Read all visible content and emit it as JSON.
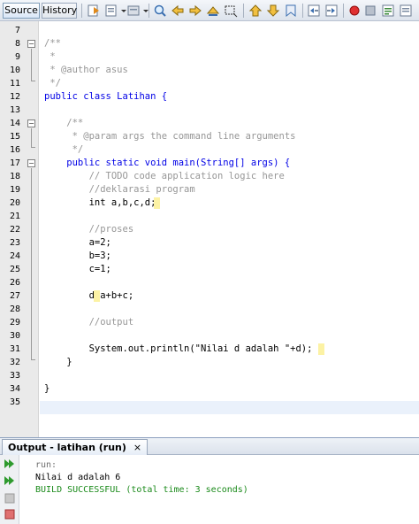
{
  "tabs": {
    "source": "Source",
    "history": "History"
  },
  "colors": {
    "keyword": "#0000e6",
    "comment": "#969696",
    "string": "#ce7b00",
    "highlight": "#fcf2a4",
    "success": "#1a8a1a"
  },
  "toolbar_icons": [
    "back-icon",
    "forward-icon",
    "go-to-icon",
    "find-previous-icon",
    "find-next-icon",
    "find-selection-icon",
    "toggle-highlight-icon",
    "toggle-rectangular-icon",
    "shift-left-icon",
    "shift-right-icon",
    "toggle-bookmark-icon",
    "previous-bookmark-icon",
    "next-bookmark-icon",
    "comment-icon",
    "uncomment-icon",
    "start-macro-icon",
    "stop-macro-icon",
    "run-icon"
  ],
  "editor": {
    "lines": [
      {
        "n": "7",
        "t": ""
      },
      {
        "n": "8",
        "t": "/**"
      },
      {
        "n": "9",
        "t": " *"
      },
      {
        "n": "10",
        "t": " * @author asus"
      },
      {
        "n": "11",
        "t": " */"
      },
      {
        "n": "12",
        "t": "public class Latihan {"
      },
      {
        "n": "13",
        "t": ""
      },
      {
        "n": "14",
        "t": "    /**"
      },
      {
        "n": "15",
        "t": "     * @param args the command line arguments"
      },
      {
        "n": "16",
        "t": "     */"
      },
      {
        "n": "17",
        "t": "    public static void main(String[] args) {"
      },
      {
        "n": "18",
        "t": "        // TODO code application logic here"
      },
      {
        "n": "19",
        "t": "        //deklarasi program"
      },
      {
        "n": "20",
        "t": "        int a,b,c,d;"
      },
      {
        "n": "21",
        "t": ""
      },
      {
        "n": "22",
        "t": "        //proses"
      },
      {
        "n": "23",
        "t": "        a=2;"
      },
      {
        "n": "24",
        "t": "        b=3;"
      },
      {
        "n": "25",
        "t": "        c=1;"
      },
      {
        "n": "26",
        "t": ""
      },
      {
        "n": "27",
        "t": "        d=a+b+c;"
      },
      {
        "n": "28",
        "t": ""
      },
      {
        "n": "29",
        "t": "        //output"
      },
      {
        "n": "30",
        "t": ""
      },
      {
        "n": "31",
        "t": "        System.out.println(\"Nilai d adalah \"+d);"
      },
      {
        "n": "32",
        "t": "    }"
      },
      {
        "n": "33",
        "t": ""
      },
      {
        "n": "34",
        "t": "}"
      },
      {
        "n": "35",
        "t": ""
      }
    ]
  },
  "output": {
    "tab_label": "Output - latihan (run)",
    "close": "×",
    "lines": [
      "run:",
      "Nilai d adalah 6",
      "BUILD SUCCESSFUL (total time: 3 seconds)"
    ]
  }
}
